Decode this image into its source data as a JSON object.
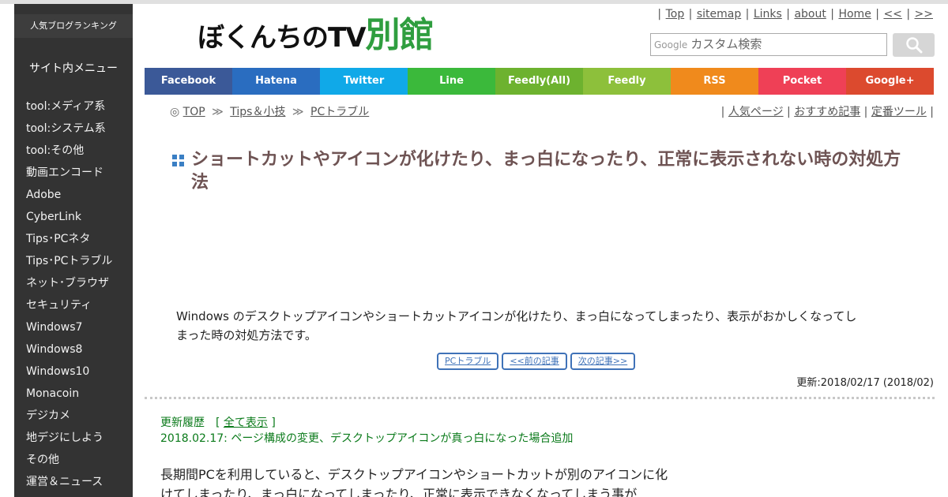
{
  "sidebar": {
    "ranking": "人気ブログランキング",
    "menu_title": "サイト内メニュー",
    "items": [
      "tool:メディア系",
      "tool:システム系",
      "tool:その他",
      "動画エンコード",
      "Adobe",
      "CyberLink",
      "Tips･PCネタ",
      "Tips･PCトラブル",
      "ネット･ブラウザ",
      "セキュリティ",
      "Windows7",
      "Windows8",
      "Windows10",
      "Monacoin",
      "デジカメ",
      "地デジにしよう",
      "その他",
      "運営＆ニュース"
    ]
  },
  "header": {
    "logo_main": "ぼくんちのTV",
    "logo_accent": "別館",
    "links": [
      "Top",
      "sitemap",
      "Links",
      "about",
      "Home",
      "<<",
      ">>"
    ],
    "search_placeholder": "カスタム検索",
    "search_brand": "Google"
  },
  "social": {
    "buttons": [
      {
        "label": "Facebook",
        "color": "#3b5998"
      },
      {
        "label": "Hatena",
        "color": "#2a6dc0"
      },
      {
        "label": "Twitter",
        "color": "#10a9e8"
      },
      {
        "label": "Line",
        "color": "#3bb93b"
      },
      {
        "label": "Feedly(All)",
        "color": "#6db22f"
      },
      {
        "label": "Feedly",
        "color": "#8dc03b"
      },
      {
        "label": "RSS",
        "color": "#f08a1c"
      },
      {
        "label": "Pocket",
        "color": "#ef4056"
      },
      {
        "label": "Google+",
        "color": "#dc4a2e"
      }
    ]
  },
  "breadcrumb": {
    "prefix": "◎",
    "items": [
      "TOP",
      "Tips＆小技",
      "PCトラブル"
    ],
    "sep": "≫"
  },
  "quicklinks": [
    "人気ページ",
    "おすすめ記事",
    "定番ツール"
  ],
  "article": {
    "title": "ショートカットやアイコンが化けたり、まっ白になったり、正常に表示されない時の対処方法",
    "intro": "Windows のデスクトップアイコンやショートカットアイコンが化けたり、まっ白になってしまったり、表示がおかしくなってしまった時の対処方法です。",
    "nav": [
      "PCトラブル",
      "<<前の記事",
      "次の記事>>"
    ],
    "updated": "更新:2018/02/17 (2018/02)",
    "history_label": "更新履歴",
    "history_link": "全て表示",
    "history_entry": "2018.02.17: ページ構成の変更、デスクトップアイコンが真っ白になった場合追加",
    "body": "長期間PCを利用していると、デスクトップアイコンやショートカットが別のアイコンに化けてしまったり、まっ白になってしまったり、正常に表示できなくなってしまう事が"
  }
}
